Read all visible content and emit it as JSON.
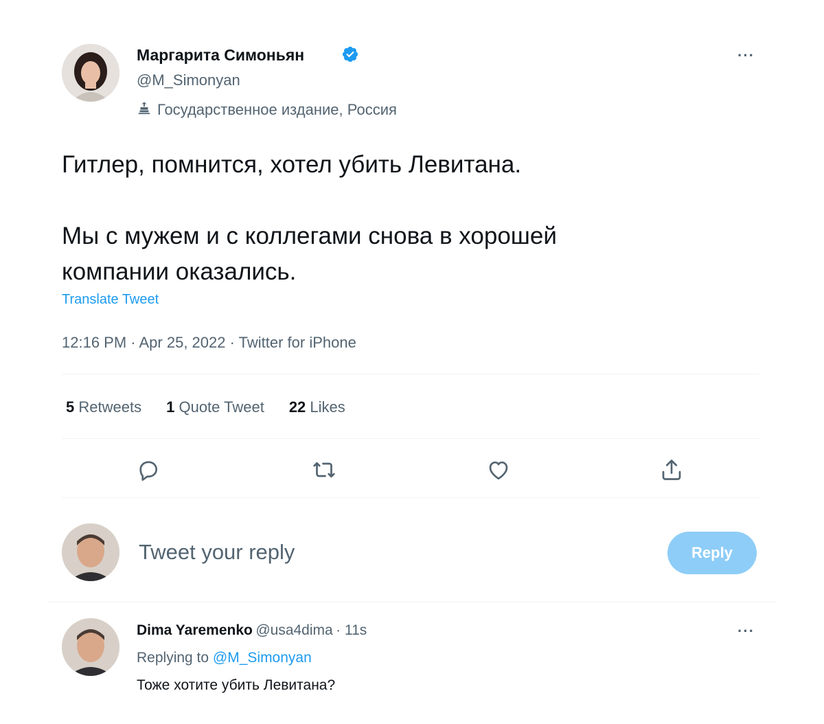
{
  "tweet": {
    "author": {
      "display_name": "Маргарита Симоньян",
      "handle": "@M_Simonyan",
      "label": "Государственное издание, Россия",
      "verified": true
    },
    "more_icon": "more-horizontal-icon",
    "text": {
      "line1": "Гитлер, помнится, хотел убить Левитана.",
      "line2": "Мы с мужем и с коллегами снова в хорошей",
      "line3": "компании оказались."
    },
    "translate_link": "Translate Tweet",
    "meta": "12:16 PM · Apr 25, 2022 · Twitter for iPhone",
    "stats": {
      "retweets_count": "5",
      "retweets_label": "Retweets",
      "quotes_count": "1",
      "quotes_label": "Quote Tweet",
      "likes_count": "22",
      "likes_label": "Likes"
    },
    "actions": [
      "reply-icon",
      "retweet-icon",
      "like-icon",
      "share-icon"
    ]
  },
  "reply_box": {
    "placeholder": "Tweet your reply",
    "button_label": "Reply"
  },
  "reply": {
    "display_name": "Dima Yaremenko",
    "handle": "@usa4dima",
    "time": "· 11s",
    "replying_prefix": "Replying to",
    "replying_mention": "@M_Simonyan",
    "text": "Тоже хотите убить Левитана?"
  },
  "colors": {
    "primary_text": "#0f1419",
    "secondary_text": "#536471",
    "accent": "#1d9bf0",
    "reply_button_bg": "#8ecdf7",
    "divider": "#eff3f4"
  }
}
